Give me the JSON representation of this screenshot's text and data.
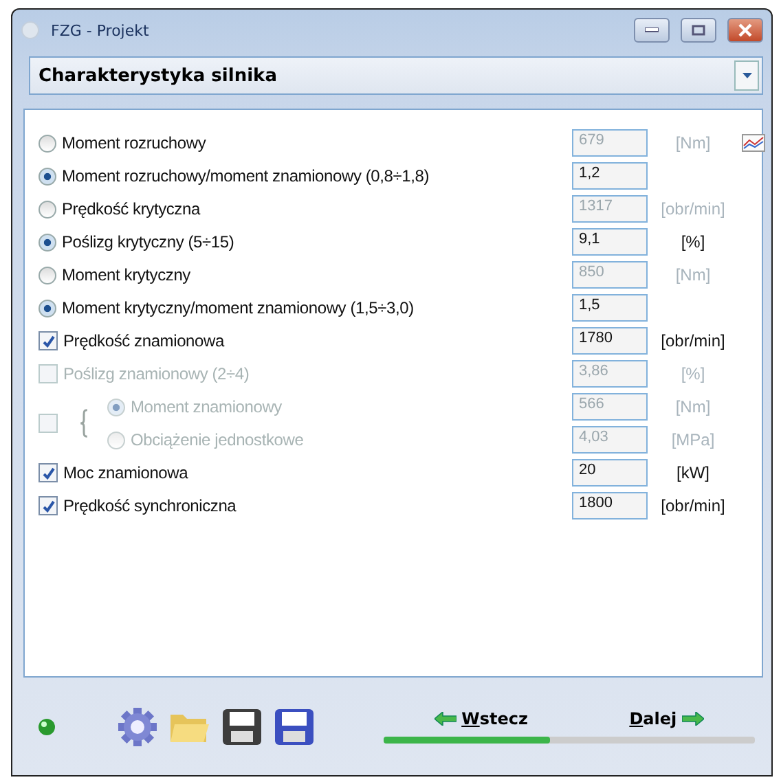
{
  "window": {
    "title": "FZG - Projekt"
  },
  "dropdown": {
    "value": "Charakterystyka silnika"
  },
  "rows": [
    {
      "kind": "radio",
      "label": "Moment rozruchowy",
      "selected": false,
      "value": "679",
      "value_disabled": true,
      "unit": "[Nm]",
      "chart_button": true
    },
    {
      "kind": "radio",
      "label": "Moment rozruchowy/moment znamionowy (0,8÷1,8)",
      "selected": true,
      "value": "1,2",
      "value_disabled": false
    },
    {
      "kind": "radio",
      "label": "Prędkość krytyczna",
      "selected": false,
      "value": "1317",
      "value_disabled": true,
      "unit": "[obr/min]"
    },
    {
      "kind": "radio",
      "label": "Poślizg krytyczny (5÷15)",
      "selected": true,
      "value": "9,1",
      "value_disabled": false,
      "unit": "[%]"
    },
    {
      "kind": "radio",
      "label": "Moment krytyczny",
      "selected": false,
      "value": "850",
      "value_disabled": true,
      "unit": "[Nm]"
    },
    {
      "kind": "radio",
      "label": "Moment krytyczny/moment znamionowy (1,5÷3,0)",
      "selected": true,
      "value": "1,5",
      "value_disabled": false
    },
    {
      "kind": "checkbox",
      "label": "Prędkość znamionowa",
      "checked": true,
      "disabled": false,
      "value": "1780",
      "value_disabled": false,
      "unit": "[obr/min]"
    },
    {
      "kind": "checkbox",
      "label": "Poślizg znamionowy (2÷4)",
      "checked": false,
      "disabled": true,
      "value": "3,86",
      "value_disabled": true,
      "unit": "[%]"
    },
    {
      "kind": "group",
      "checked": false,
      "disabled": true,
      "options": [
        {
          "label": "Moment znamionowy",
          "selected": true,
          "value": "566",
          "unit": "[Nm]"
        },
        {
          "label": "Obciążenie jednostkowe",
          "selected": false,
          "value": "4,03",
          "unit": "[MPa]"
        }
      ]
    },
    {
      "kind": "checkbox",
      "label": "Moc znamionowa",
      "checked": true,
      "disabled": false,
      "value": "20",
      "value_disabled": false,
      "unit": "[kW]"
    },
    {
      "kind": "checkbox",
      "label": "Prędkość synchroniczna",
      "checked": true,
      "disabled": false,
      "value": "1800",
      "value_disabled": false,
      "unit": "[obr/min]"
    }
  ],
  "footer": {
    "status_ok": true,
    "back": {
      "label": "Wstecz"
    },
    "next": {
      "label": "Dalej"
    },
    "progress": {
      "level": 0.45
    }
  }
}
